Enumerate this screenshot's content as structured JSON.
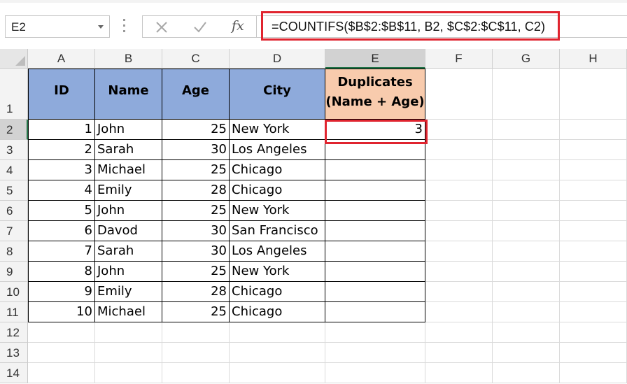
{
  "name_box": {
    "value": "E2"
  },
  "formula_bar": {
    "cancel_icon": "close-icon",
    "enter_icon": "checkmark-icon",
    "function_icon": "fx-icon",
    "function_label": "fx",
    "formula": "=COUNTIFS($B$2:$B$11, B2, $C$2:$C$11, C2)",
    "highlight_color": "#e0242f"
  },
  "columns": [
    "A",
    "B",
    "C",
    "D",
    "E",
    "F",
    "G",
    "H"
  ],
  "selected_column": "E",
  "rows": [
    "1",
    "2",
    "3",
    "4",
    "5",
    "6",
    "7",
    "8",
    "9",
    "10",
    "11",
    "12",
    "13",
    "14"
  ],
  "selected_row": "2",
  "table": {
    "headers": [
      "ID",
      "Name",
      "Age",
      "City"
    ],
    "duplicates_header": [
      "Duplicates",
      "(Name + Age)"
    ],
    "header_fill": "#8eaadb",
    "duplicates_fill": "#f8cbad",
    "rows": [
      [
        "1",
        "John",
        "25",
        "New York"
      ],
      [
        "2",
        "Sarah",
        "30",
        "Los Angeles"
      ],
      [
        "3",
        "Michael",
        "25",
        "Chicago"
      ],
      [
        "4",
        "Emily",
        "28",
        "Chicago"
      ],
      [
        "5",
        "John",
        "25",
        "New York"
      ],
      [
        "6",
        "Davod",
        "30",
        "San Francisco"
      ],
      [
        "7",
        "Sarah",
        "30",
        "Los Angeles"
      ],
      [
        "8",
        "John",
        "25",
        "New York"
      ],
      [
        "9",
        "Emily",
        "28",
        "Chicago"
      ],
      [
        "10",
        "Michael",
        "25",
        "Chicago"
      ]
    ],
    "duplicates_values": [
      "3",
      "",
      "",
      "",
      "",
      "",
      "",
      "",
      "",
      ""
    ]
  }
}
